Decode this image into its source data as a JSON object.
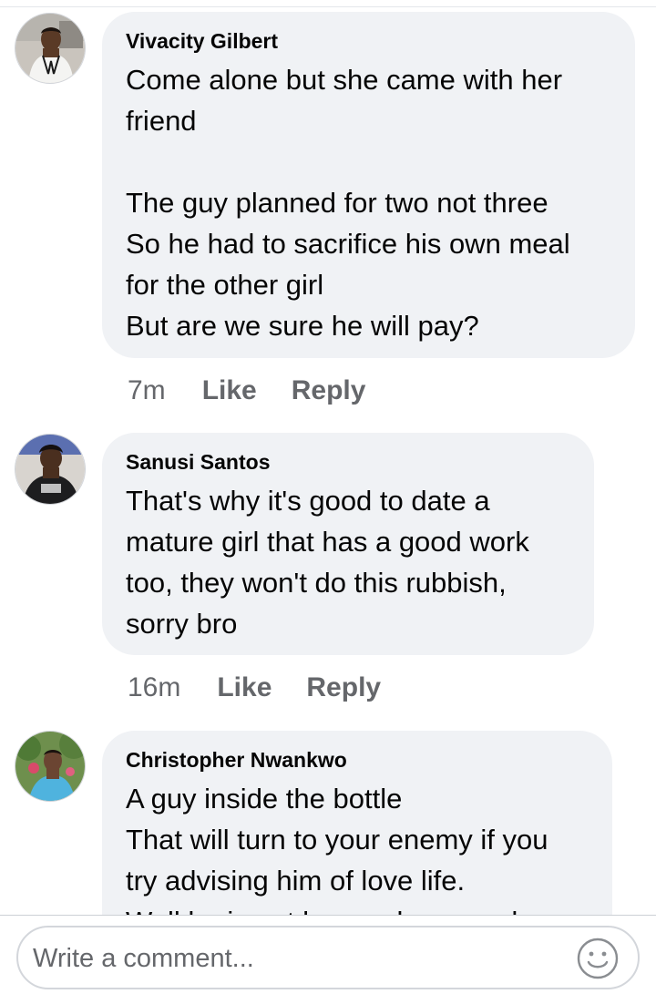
{
  "comments": [
    {
      "author": "Vivacity Gilbert",
      "text": "Come alone but she came with her\nfriend\n\nThe guy planned for two not three\nSo he had to sacrifice his own meal\nfor the other girl\nBut are we sure he will pay?",
      "time": "7m",
      "like_label": "Like",
      "reply_label": "Reply",
      "avatar_icon": "profile-photo-icon"
    },
    {
      "author": "Sanusi Santos",
      "text": "That's why it's good to date a\nmature girl that has a good work\ntoo, they won't do this rubbish,\nsorry bro",
      "time": "16m",
      "like_label": "Like",
      "reply_label": "Reply",
      "avatar_icon": "profile-photo-icon"
    },
    {
      "author": "Christopher Nwankwo",
      "text": "A guy inside the bottle\nThat will turn to your enemy if you\ntry advising him of love life.\nWell he is not hungry because he",
      "avatar_icon": "profile-photo-icon"
    }
  ],
  "composer": {
    "placeholder": "Write a comment...",
    "emoji_icon": "smiley-face-icon"
  },
  "colors": {
    "bubble": "#f0f2f5",
    "text": "#050505",
    "meta": "#65676b",
    "border": "#d3d6db"
  }
}
